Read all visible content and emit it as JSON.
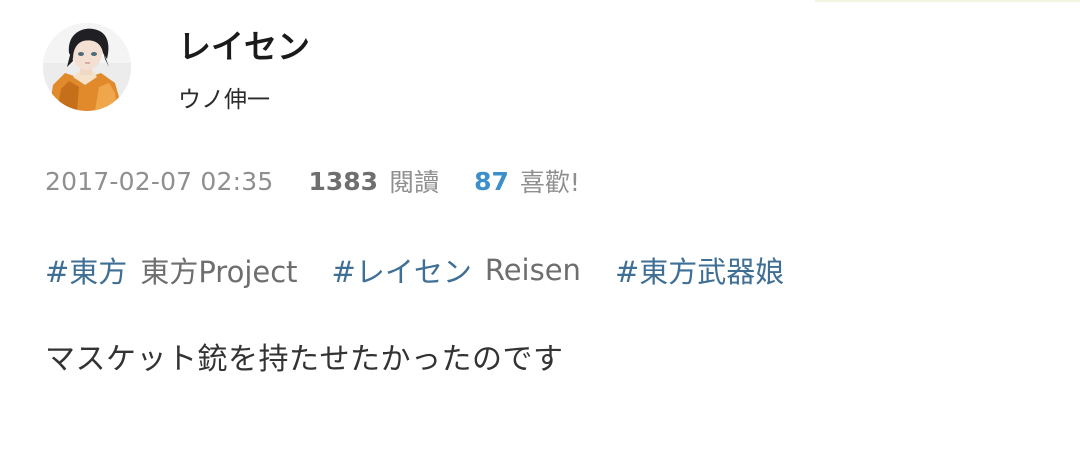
{
  "post": {
    "title": "レイセン",
    "author": "ウノ伸一",
    "date": "2017-02-07 02:35",
    "views_count": "1383",
    "views_label": "閱讀",
    "likes_count": "87",
    "likes_label": "喜歡!",
    "description": "マスケット銃を持たせたかったのです"
  },
  "tags": [
    {
      "name": "#東方",
      "translation": "東方Project"
    },
    {
      "name": "#レイセン",
      "translation": "Reisen"
    },
    {
      "name": "#東方武器娘",
      "translation": ""
    }
  ],
  "colors": {
    "tag": "#3f6f94",
    "likes": "#3d8fcb",
    "meta": "#8f8f8f",
    "title": "#1b1b1b"
  }
}
